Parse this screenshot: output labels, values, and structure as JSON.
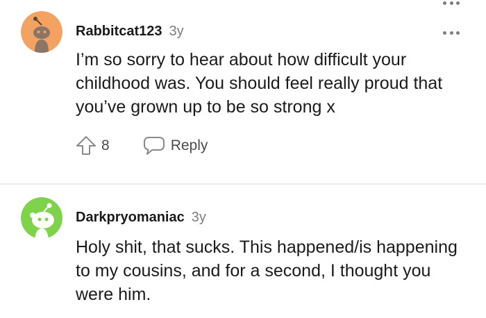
{
  "comments": [
    {
      "username": "Rabbitcat123",
      "age": "3y",
      "text": "I’m so sorry to hear about how difficult your childhood was. You should feel really proud that you’ve grown up to be so strong x",
      "upvotes": "8",
      "reply_label": "Reply",
      "avatar_bg": "#f4a262"
    },
    {
      "username": "Darkpryomaniac",
      "age": "3y",
      "text": "Holy shit, that sucks. This happened/is happening to my cousins, and for a second, I thought you were him.",
      "avatar_bg": "#7ed34b"
    }
  ],
  "icons": {
    "more": "more-options-icon",
    "upvote": "upvote-arrow-icon",
    "reply": "speech-bubble-icon"
  }
}
